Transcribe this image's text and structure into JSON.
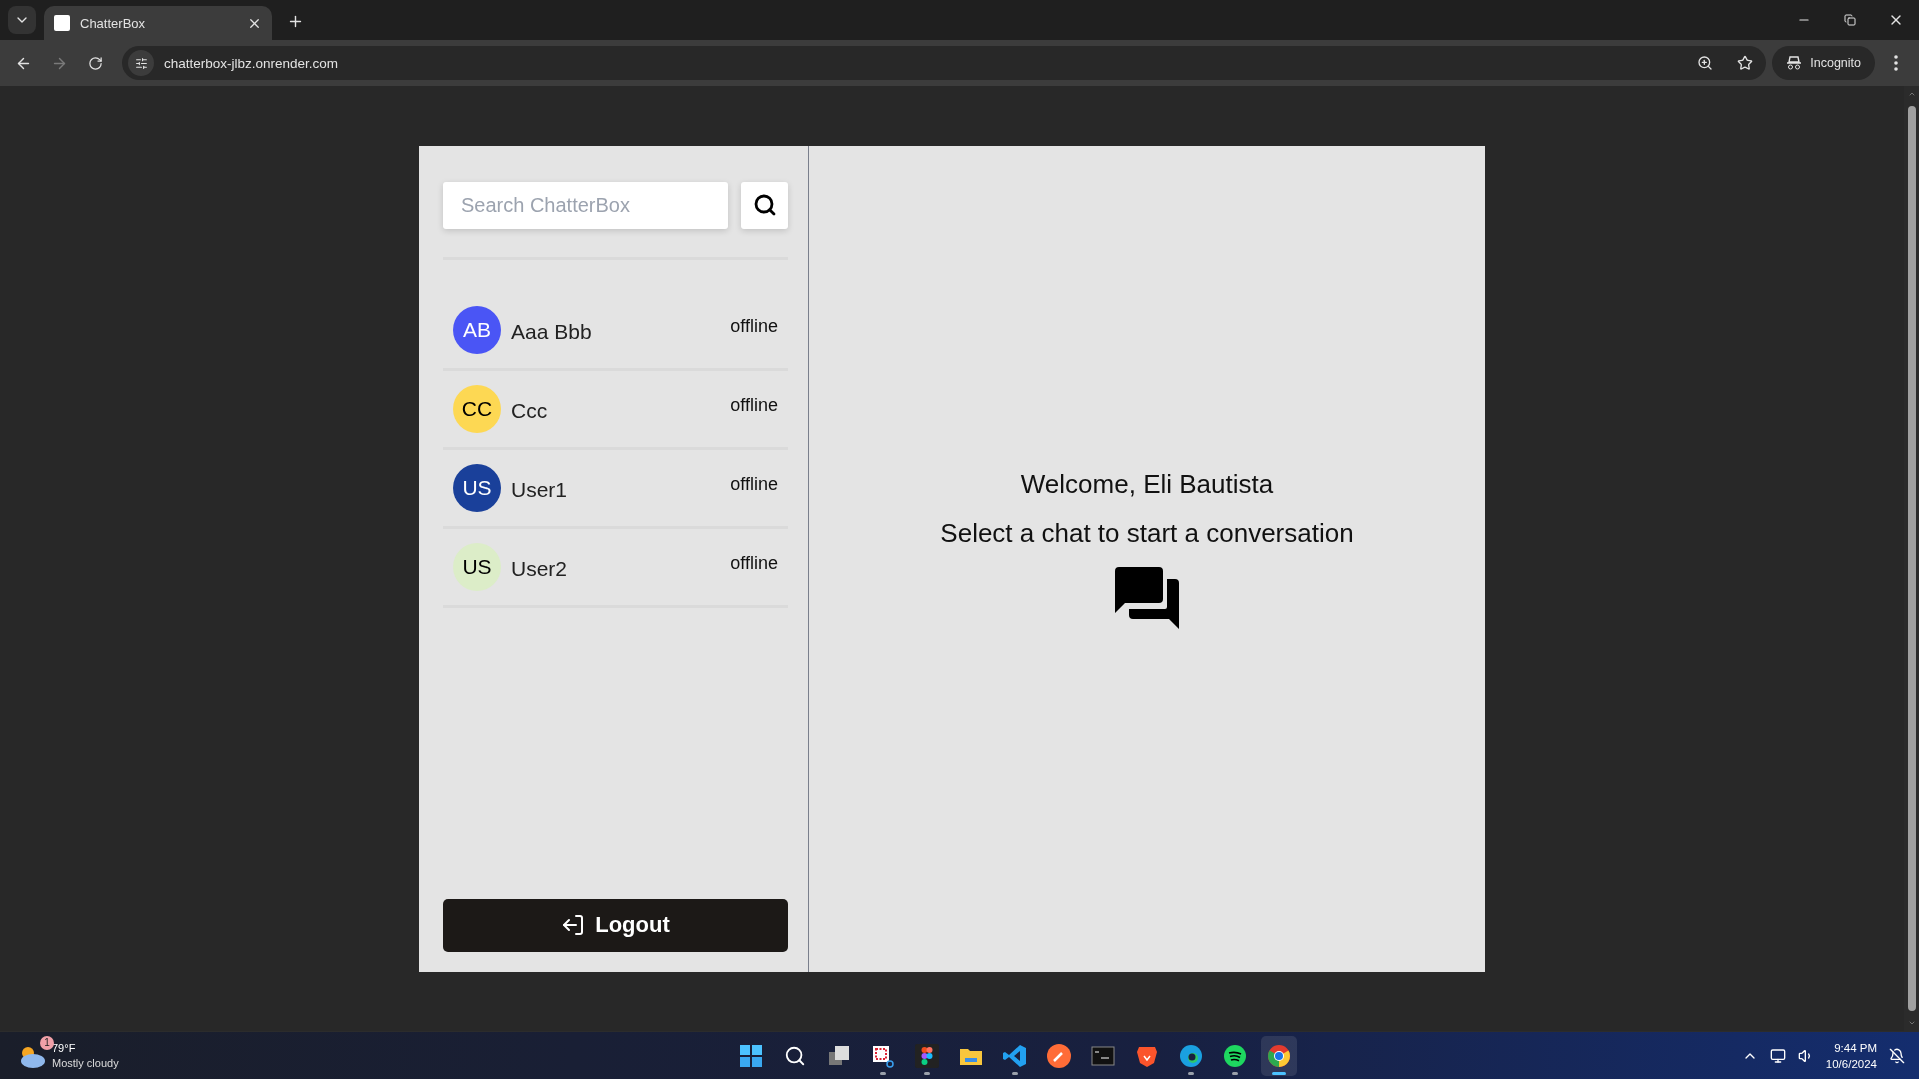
{
  "browser": {
    "tab": {
      "title": "ChatterBox",
      "selected": true
    },
    "url": "chatterbox-jlbz.onrender.com",
    "profile": "Incognito"
  },
  "sidebar": {
    "search": {
      "placeholder": "Search ChatterBox"
    },
    "users": [
      {
        "initials": "AB",
        "name": "Aaa Bbb",
        "status": "offline",
        "color": "#4a55f5",
        "selected": false
      },
      {
        "initials": "CC",
        "name": "Ccc",
        "status": "offline",
        "color": "#fdd853",
        "selected": false
      },
      {
        "initials": "US",
        "name": "User1",
        "status": "offline",
        "color": "#1a409a",
        "selected": false
      },
      {
        "initials": "US",
        "name": "User2",
        "status": "offline",
        "color": "#dcedc8",
        "selected": false
      }
    ],
    "logout": "Logout"
  },
  "main": {
    "welcome": "Welcome, Eli Bautista",
    "prompt": "Select a chat to start a conversation"
  },
  "taskbar": {
    "weather": {
      "badge": "1",
      "temperature": "79°F",
      "condition": "Mostly cloudy"
    },
    "apps": [
      {
        "kind": "start",
        "running": false,
        "selected": false
      },
      {
        "kind": "search",
        "running": false,
        "selected": false
      },
      {
        "kind": "taskview",
        "running": false,
        "selected": false
      },
      {
        "kind": "snip",
        "running": true,
        "selected": false
      },
      {
        "kind": "figma",
        "running": true,
        "selected": false
      },
      {
        "kind": "folder",
        "running": false,
        "selected": false
      },
      {
        "kind": "code",
        "running": true,
        "selected": false
      },
      {
        "kind": "postman",
        "running": false,
        "selected": false
      },
      {
        "kind": "terminal",
        "running": false,
        "selected": false
      },
      {
        "kind": "brave",
        "running": false,
        "selected": false
      },
      {
        "kind": "edge",
        "running": true,
        "selected": false
      },
      {
        "kind": "spotify",
        "running": true,
        "selected": false
      },
      {
        "kind": "chrome",
        "running": true,
        "selected": true
      }
    ],
    "time": "9:44 PM",
    "date": "10/6/2024"
  }
}
